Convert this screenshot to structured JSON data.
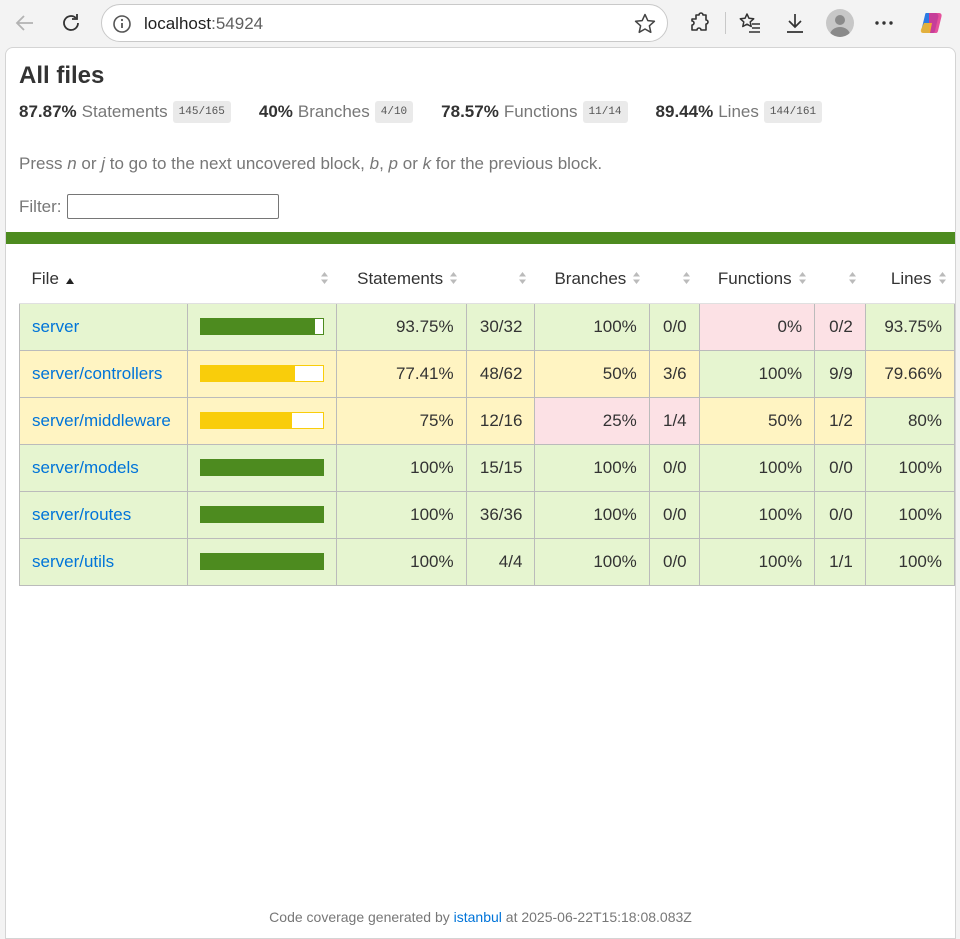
{
  "browser": {
    "url_host": "localhost",
    "url_port": ":54924"
  },
  "page": {
    "title": "All files",
    "summary": [
      {
        "pct": "87.87%",
        "label": "Statements",
        "frac": "145/165"
      },
      {
        "pct": "40%",
        "label": "Branches",
        "frac": "4/10"
      },
      {
        "pct": "78.57%",
        "label": "Functions",
        "frac": "11/14"
      },
      {
        "pct": "89.44%",
        "label": "Lines",
        "frac": "144/161"
      }
    ],
    "hint": {
      "p1": "Press ",
      "k1": "n",
      "p2": " or ",
      "k2": "j",
      "p3": " to go to the next uncovered block, ",
      "k3": "b",
      "p4": ", ",
      "k4": "p",
      "p5": " or ",
      "k5": "k",
      "p6": " for the previous block."
    },
    "filter_label": "Filter:",
    "filter_value": "",
    "status_color": "#4d8b1f"
  },
  "table": {
    "headers": {
      "file": "File",
      "statements": "Statements",
      "branches": "Branches",
      "functions": "Functions",
      "lines": "Lines"
    },
    "rows": [
      {
        "file": "server",
        "level": "high",
        "coverage": 93.75,
        "statements_pct": "93.75%",
        "statements_frac": "30/32",
        "statements_level": "high",
        "branches_pct": "100%",
        "branches_frac": "0/0",
        "branches_level": "high",
        "functions_pct": "0%",
        "functions_frac": "0/2",
        "functions_level": "low",
        "lines_pct": "93.75%",
        "lines_level": "high"
      },
      {
        "file": "server/controllers",
        "level": "medium",
        "coverage": 77.41,
        "statements_pct": "77.41%",
        "statements_frac": "48/62",
        "statements_level": "medium",
        "branches_pct": "50%",
        "branches_frac": "3/6",
        "branches_level": "medium",
        "functions_pct": "100%",
        "functions_frac": "9/9",
        "functions_level": "high",
        "lines_pct": "79.66%",
        "lines_level": "medium"
      },
      {
        "file": "server/middleware",
        "level": "medium",
        "coverage": 75,
        "statements_pct": "75%",
        "statements_frac": "12/16",
        "statements_level": "medium",
        "branches_pct": "25%",
        "branches_frac": "1/4",
        "branches_level": "low",
        "functions_pct": "50%",
        "functions_frac": "1/2",
        "functions_level": "medium",
        "lines_pct": "80%",
        "lines_level": "high"
      },
      {
        "file": "server/models",
        "level": "high",
        "coverage": 100,
        "statements_pct": "100%",
        "statements_frac": "15/15",
        "statements_level": "high",
        "branches_pct": "100%",
        "branches_frac": "0/0",
        "branches_level": "high",
        "functions_pct": "100%",
        "functions_frac": "0/0",
        "functions_level": "high",
        "lines_pct": "100%",
        "lines_level": "high"
      },
      {
        "file": "server/routes",
        "level": "high",
        "coverage": 100,
        "statements_pct": "100%",
        "statements_frac": "36/36",
        "statements_level": "high",
        "branches_pct": "100%",
        "branches_frac": "0/0",
        "branches_level": "high",
        "functions_pct": "100%",
        "functions_frac": "0/0",
        "functions_level": "high",
        "lines_pct": "100%",
        "lines_level": "high"
      },
      {
        "file": "server/utils",
        "level": "high",
        "coverage": 100,
        "statements_pct": "100%",
        "statements_frac": "4/4",
        "statements_level": "high",
        "branches_pct": "100%",
        "branches_frac": "0/0",
        "branches_level": "high",
        "functions_pct": "100%",
        "functions_frac": "1/1",
        "functions_level": "high",
        "lines_pct": "100%",
        "lines_level": "high"
      }
    ]
  },
  "footer": {
    "prefix": "Code coverage generated by ",
    "link": "istanbul",
    "suffix": " at 2025-06-22T15:18:08.083Z"
  },
  "colors": {
    "high": "#e6f5d0",
    "medium": "#fff4c2",
    "low": "#fce1e5",
    "bar_high": "#4d8b1f",
    "bar_medium": "#f9cd0b",
    "link": "#0074d9"
  }
}
